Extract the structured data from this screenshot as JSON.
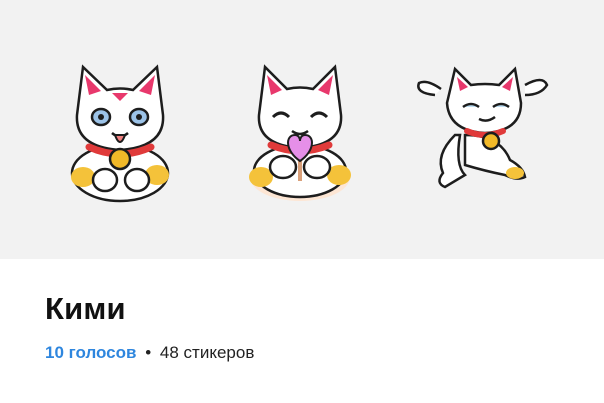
{
  "pack": {
    "title": "Кими",
    "votes_label": "10 голосов",
    "separator": "•",
    "count_label": "48 стикеров"
  },
  "stickers": [
    {
      "name": "cat-sticker-tongue",
      "icon": "maneki-cat-tongue"
    },
    {
      "name": "cat-sticker-heart",
      "icon": "maneki-cat-heart-lollipop"
    },
    {
      "name": "cat-sticker-jump",
      "icon": "maneki-cat-jumping"
    }
  ],
  "colors": {
    "preview_bg": "#f2f2f2",
    "accent_link": "#2e86de",
    "collar": "#e03a3a",
    "bell": "#f2b928",
    "ear_inner": "#e8386c"
  }
}
